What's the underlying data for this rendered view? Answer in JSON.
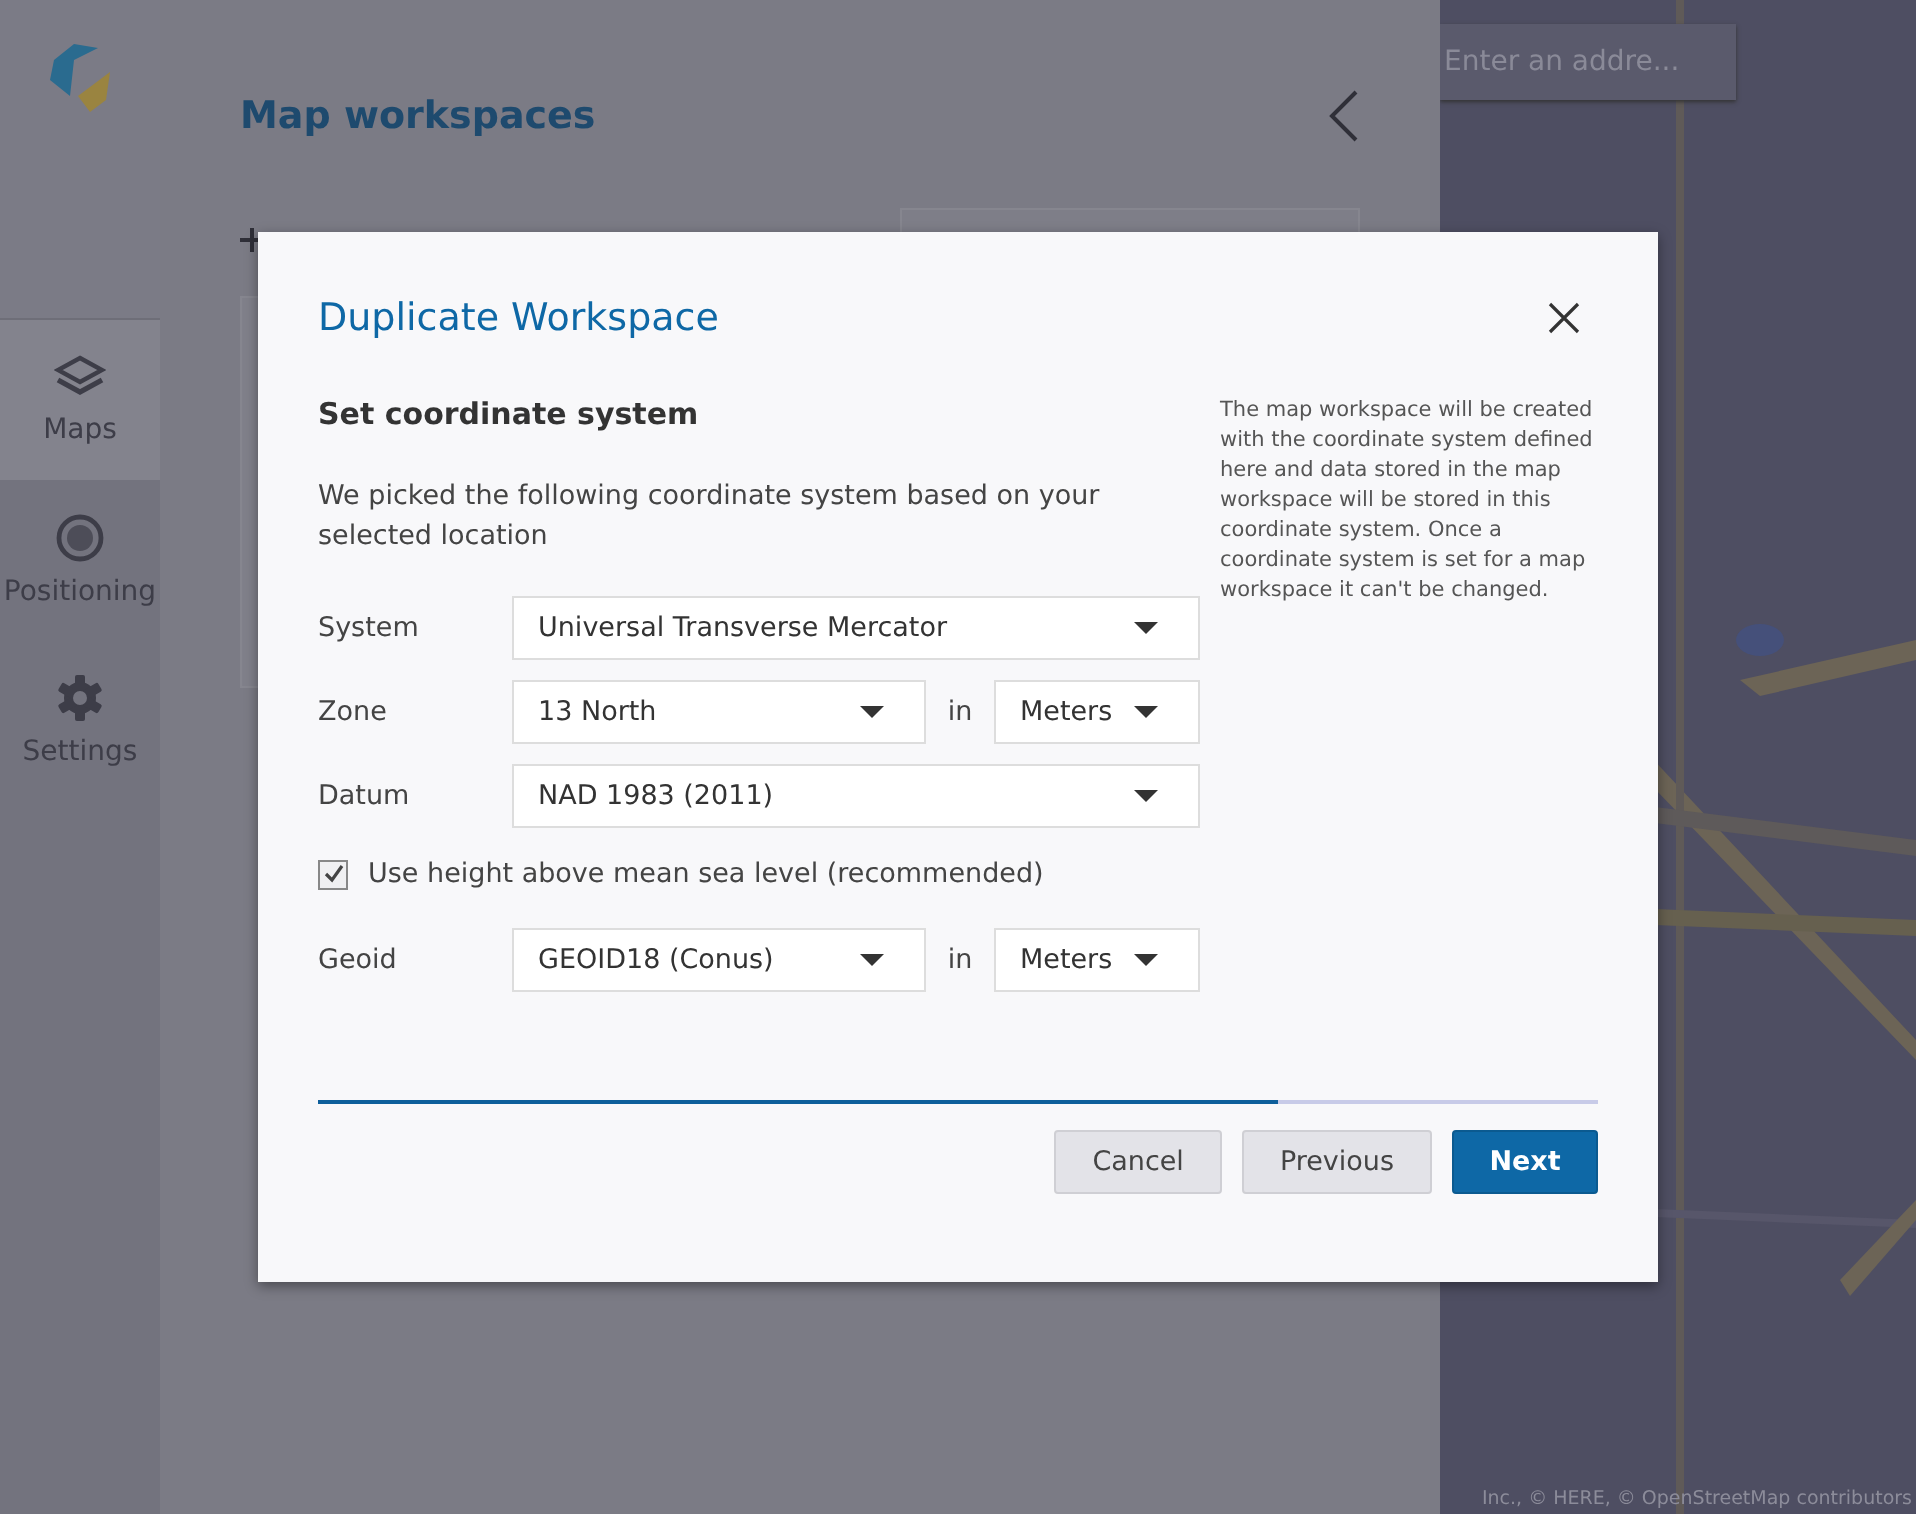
{
  "sidebar": {
    "nav": [
      {
        "label": "Maps",
        "selected": true
      },
      {
        "label": "Positioning",
        "selected": false
      },
      {
        "label": "Settings",
        "selected": false
      }
    ]
  },
  "main": {
    "title": "Map workspaces"
  },
  "map": {
    "search": {
      "placeholder": "Enter an addre..."
    },
    "attribution": "Inc., © HERE, © OpenStreetMap contributors"
  },
  "dialog": {
    "title": "Duplicate Workspace",
    "section": "Set coordinate system",
    "intro": "We picked the following coordinate system based on your selected location",
    "help": "The map workspace will be created with the coordinate system defined here and data stored in the map workspace will be stored in this coordinate system. Once a coordinate system is set for a map workspace it can't be changed.",
    "fields": [
      {
        "kind": "select",
        "label": "System",
        "value": "Universal Transverse Mercator"
      },
      {
        "kind": "units",
        "label": "Zone",
        "value": "13 North",
        "joiner": "in",
        "unit": "Meters"
      },
      {
        "kind": "select",
        "label": "Datum",
        "value": "NAD 1983 (2011)"
      },
      {
        "kind": "checkbox",
        "label": "Use height above mean sea level (recommended)",
        "checked": true
      },
      {
        "kind": "units",
        "label": "Geoid",
        "value": "GEOID18 (Conus)",
        "joiner": "in",
        "unit": "Meters"
      }
    ],
    "progress": {
      "level": 0.75
    },
    "buttons": [
      {
        "label": "Cancel",
        "kind": "secondary"
      },
      {
        "label": "Previous",
        "kind": "secondary"
      },
      {
        "label": "Next",
        "kind": "primary"
      }
    ]
  }
}
